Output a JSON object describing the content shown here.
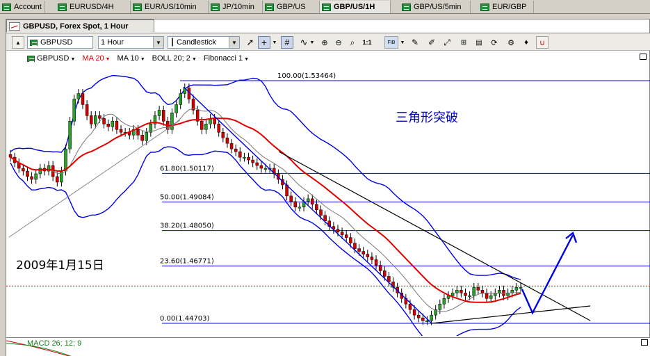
{
  "tabs": [
    {
      "label": "Account"
    },
    {
      "label": "EURUSD/4H"
    },
    {
      "label": "EUR/US/10min"
    },
    {
      "label": "JP/10min"
    },
    {
      "label": "GBP/US"
    },
    {
      "label": "GBP/US/1H"
    },
    {
      "label": "GBP/US/5min"
    },
    {
      "label": "EUR/GBP"
    }
  ],
  "active_tab": "GBP/US/1H",
  "window_title": "GBPUSD, Forex Spot, 1 Hour",
  "toolbar": {
    "instrument": "GBPUSD",
    "period": "1 Hour",
    "chart_type": "Candlestick",
    "one_to_one": "1:1",
    "fib": "FIB"
  },
  "legend": {
    "instrument": "GBPUSD",
    "ma20": "MA 20",
    "ma10": "MA 10",
    "boll": "BOLL 20; 2",
    "fib": "Fibonacci 1"
  },
  "annotations": {
    "pattern_title": "三角形突破",
    "date": "2009年1月15日"
  },
  "subpanel_label": "MACD 26; 12; 9",
  "colors": {
    "blue_line": "#0000e0",
    "red_ma": "#e00000",
    "candle_up": "#2aa02a",
    "candle_down": "#d40000"
  },
  "chart_data": {
    "type": "candlestick",
    "fib_levels": [
      {
        "label": "100.00(1.53464)",
        "value": 1.53464
      },
      {
        "label": "61.80(1.50117)",
        "value": 1.50117
      },
      {
        "label": "50.00(1.49084)",
        "value": 1.49084
      },
      {
        "label": "38.20(1.48050)",
        "value": 1.4805
      },
      {
        "label": "23.60(1.46771)",
        "value": 1.46771
      },
      {
        "label": "0.00(1.44703)",
        "value": 1.44703
      }
    ],
    "current_price": 1.4605,
    "ylim": [
      1.4425,
      1.5375
    ],
    "candles_close": [
      1.507,
      1.505,
      1.503,
      1.502,
      1.5,
      1.499,
      1.501,
      1.503,
      1.502,
      1.504,
      1.5,
      1.498,
      1.502,
      1.51,
      1.52,
      1.528,
      1.53,
      1.526,
      1.522,
      1.519,
      1.522,
      1.521,
      1.519,
      1.518,
      1.52,
      1.517,
      1.516,
      1.516,
      1.515,
      1.517,
      1.515,
      1.513,
      1.516,
      1.519,
      1.522,
      1.524,
      1.52,
      1.517,
      1.523,
      1.526,
      1.53,
      1.532,
      1.528,
      1.524,
      1.52,
      1.517,
      1.519,
      1.521,
      1.519,
      1.516,
      1.514,
      1.512,
      1.51,
      1.509,
      1.507,
      1.507,
      1.506,
      1.505,
      1.504,
      1.503,
      1.503,
      1.503,
      1.501,
      1.499,
      1.497,
      1.493,
      1.491,
      1.489,
      1.489,
      1.491,
      1.492,
      1.49,
      1.488,
      1.486,
      1.484,
      1.482,
      1.481,
      1.48,
      1.479,
      1.478,
      1.476,
      1.474,
      1.473,
      1.472,
      1.471,
      1.47,
      1.468,
      1.466,
      1.464,
      1.462,
      1.46,
      1.458,
      1.456,
      1.454,
      1.452,
      1.45,
      1.449,
      1.448,
      1.448,
      1.45,
      1.452,
      1.454,
      1.456,
      1.457,
      1.458,
      1.459,
      1.458,
      1.457,
      1.457,
      1.46,
      1.459,
      1.458,
      1.456,
      1.457,
      1.458,
      1.459,
      1.457,
      1.458,
      1.459,
      1.46,
      1.46
    ]
  }
}
